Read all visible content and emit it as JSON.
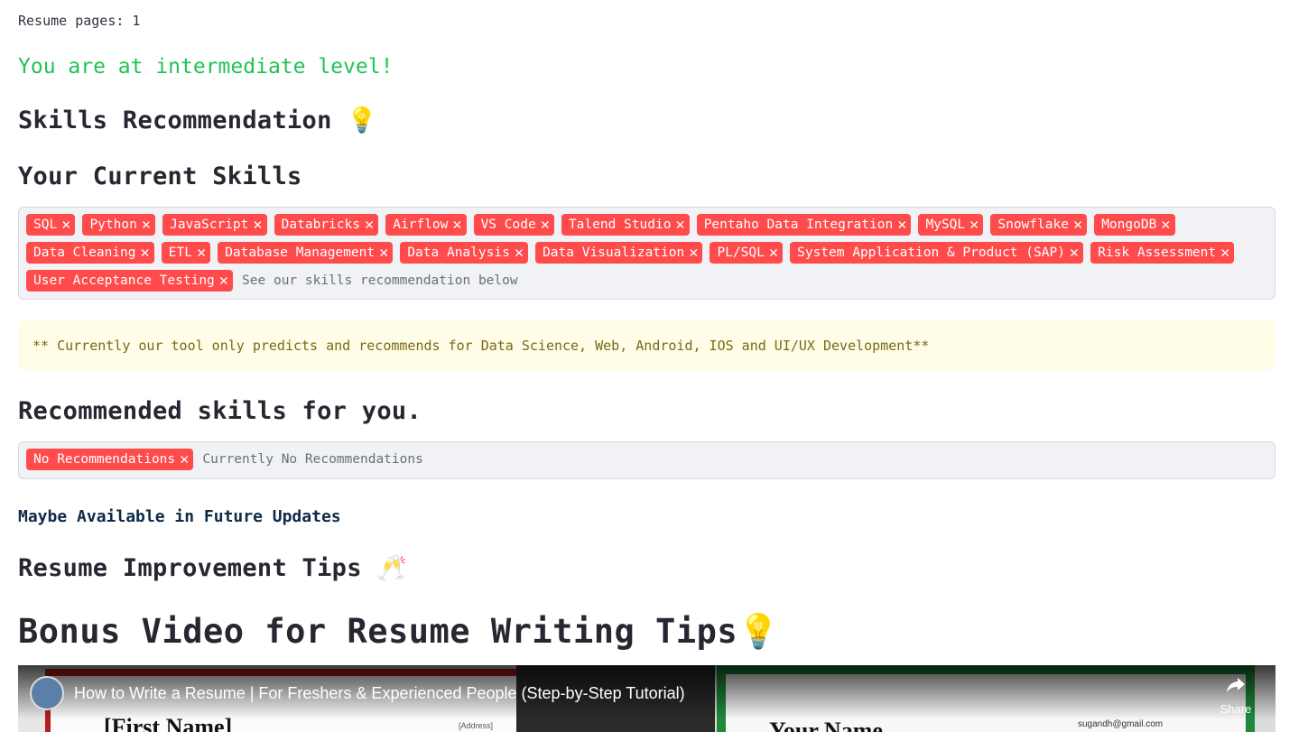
{
  "resume_pages_text": "Resume pages: 1",
  "level_text": "You are at intermediate level!",
  "skills_recommendation_heading": "Skills Recommendation",
  "skills_recommendation_emoji": "💡",
  "current_skills_heading": "Your Current Skills",
  "current_skills": {
    "tags": [
      "SQL",
      "Python",
      "JavaScript",
      "Databricks",
      "Airflow",
      "VS Code",
      "Talend Studio",
      "Pentaho Data Integration",
      "MySQL",
      "Snowflake",
      "MongoDB",
      "Data Cleaning",
      "ETL",
      "Database Management",
      "Data Analysis",
      "Data Visualization",
      "PL/SQL",
      "System Application & Product (SAP)",
      "Risk Assessment",
      "User Acceptance Testing"
    ],
    "placeholder": "See our skills recommendation below",
    "remove_glyph": "✕"
  },
  "note_text": "** Currently our tool only predicts and recommends for Data Science, Web, Android, IOS and UI/UX Development**",
  "recommended_heading": "Recommended skills for you.",
  "recommended_skills": {
    "tags": [
      "No Recommendations"
    ],
    "placeholder": "Currently No Recommendations"
  },
  "future_text": "Maybe Available in Future Updates",
  "tips_heading": "Resume Improvement Tips",
  "tips_emoji": "🥂",
  "bonus_heading": "Bonus Video for Resume Writing Tips",
  "bonus_emoji": "💡",
  "video": {
    "title": "How to Write a Resume | For Freshers & Experienced People (Step-by-Step Tutorial)",
    "share_label": "Share",
    "share_icon": "share-arrow-icon",
    "frame_text_left": "[First Name]",
    "frame_text_address": "[Address]",
    "frame_text_right": "Your Name",
    "frame_text_email": "sugandh@gmail.com"
  },
  "colors": {
    "tag_bg": "#ff4b4b",
    "level_green": "#21c354",
    "note_bg": "#fffce7",
    "tagbox_bg": "#f0f2f6"
  }
}
